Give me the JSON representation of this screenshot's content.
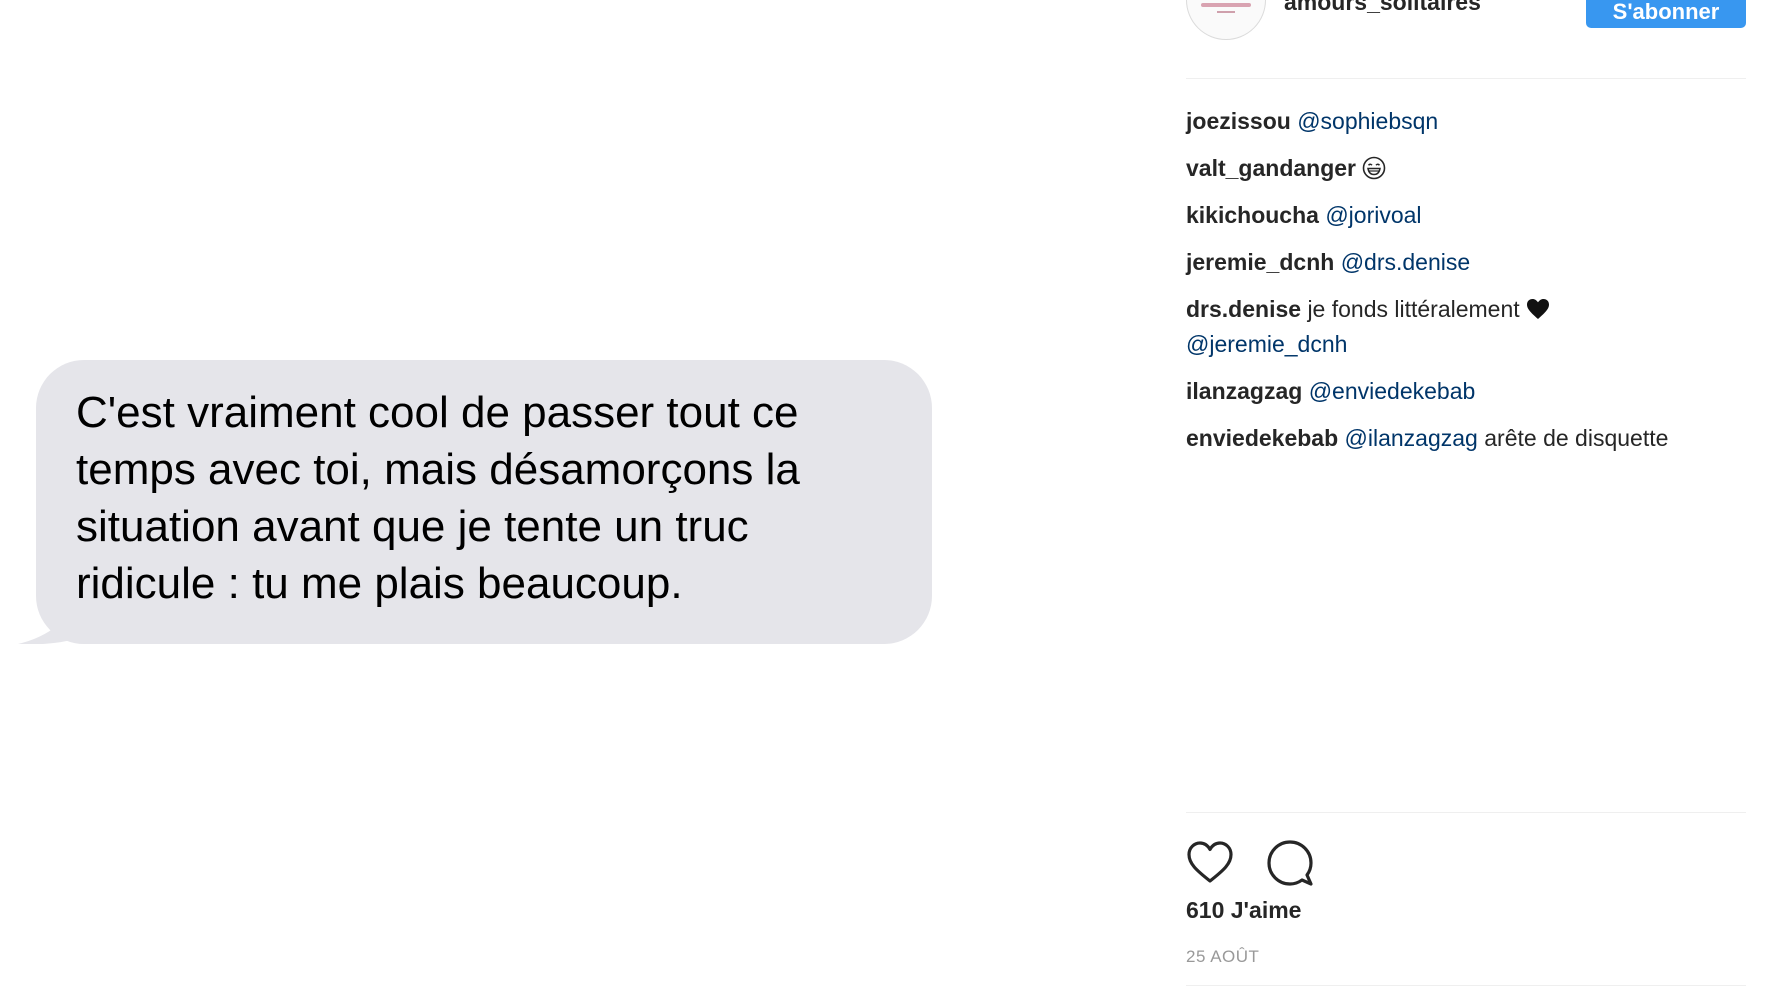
{
  "message": {
    "text": "C'est vraiment cool de passer tout ce\ntemps avec toi, mais désamorçons la\nsituation avant que je tente un truc\nridicule : tu me plais beaucoup."
  },
  "header": {
    "username": "amours_solitaires",
    "follow_label": "S'abonner"
  },
  "comments": [
    {
      "user": "joezissou",
      "mention": "@sophiebsqn",
      "text": "",
      "icon": ""
    },
    {
      "user": "valt_gandanger",
      "mention": "",
      "text": "",
      "icon": "grinning-face-icon"
    },
    {
      "user": "kikichoucha",
      "mention": "@jorivoal",
      "text": "",
      "icon": ""
    },
    {
      "user": "jeremie_dcnh",
      "mention": "@drs.denise",
      "text": "",
      "icon": ""
    },
    {
      "user": "drs.denise",
      "mention": "",
      "text": "je fonds littéralement",
      "icon": "black-heart-icon",
      "mention_after": "@jeremie_dcnh"
    },
    {
      "user": "ilanzagzag",
      "mention": "@enviedekebab",
      "text": "",
      "icon": ""
    },
    {
      "user": "enviedekebab",
      "mention": "@ilanzagzag",
      "text": "arête de disquette",
      "icon": ""
    }
  ],
  "footer": {
    "likes": "610 J'aime",
    "date": "25 AOÛT"
  },
  "colors": {
    "bubble": "#e5e5ea",
    "follow_button": "#3897f0",
    "mention": "#003569"
  }
}
